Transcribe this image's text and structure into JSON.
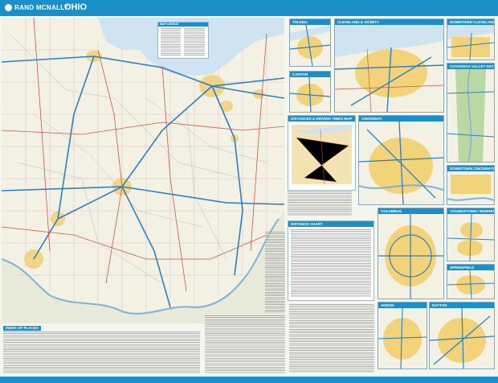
{
  "header": {
    "brand": "RAND MCNALLY",
    "state_title": "OHIO"
  },
  "main_map": {
    "legend_title": "MAP LEGEND"
  },
  "insets": [
    {
      "title": "TOLEDO"
    },
    {
      "title": "CLEVELAND & VICINITY"
    },
    {
      "title": "DOWNTOWN CLEVELAND"
    },
    {
      "title": "CANTON"
    },
    {
      "title": "CUYAHOGA VALLEY NAT'L PARK"
    },
    {
      "title": "CINCINNATI"
    },
    {
      "title": "DOWNTOWN CINCINNATI"
    },
    {
      "title": "COLUMBUS"
    },
    {
      "title": "YOUNGSTOWN / WARREN"
    },
    {
      "title": "SPRINGFIELD"
    },
    {
      "title": "AKRON"
    },
    {
      "title": "DAYTON"
    }
  ],
  "panels": {
    "mileage_map_title": "DISTANCES & DRIVING TIMES MAP",
    "distance_chart_title": "DISTANCE CHART"
  },
  "index": {
    "title": "INDEX OF PLACES"
  },
  "colors": {
    "header_blue": "#1a8fc9",
    "lake_blue": "#cfe3f0",
    "land": "#f3f1e4",
    "urban": "#f2d37a",
    "interstate": "#2c7fc1",
    "highway": "#c8584a"
  }
}
